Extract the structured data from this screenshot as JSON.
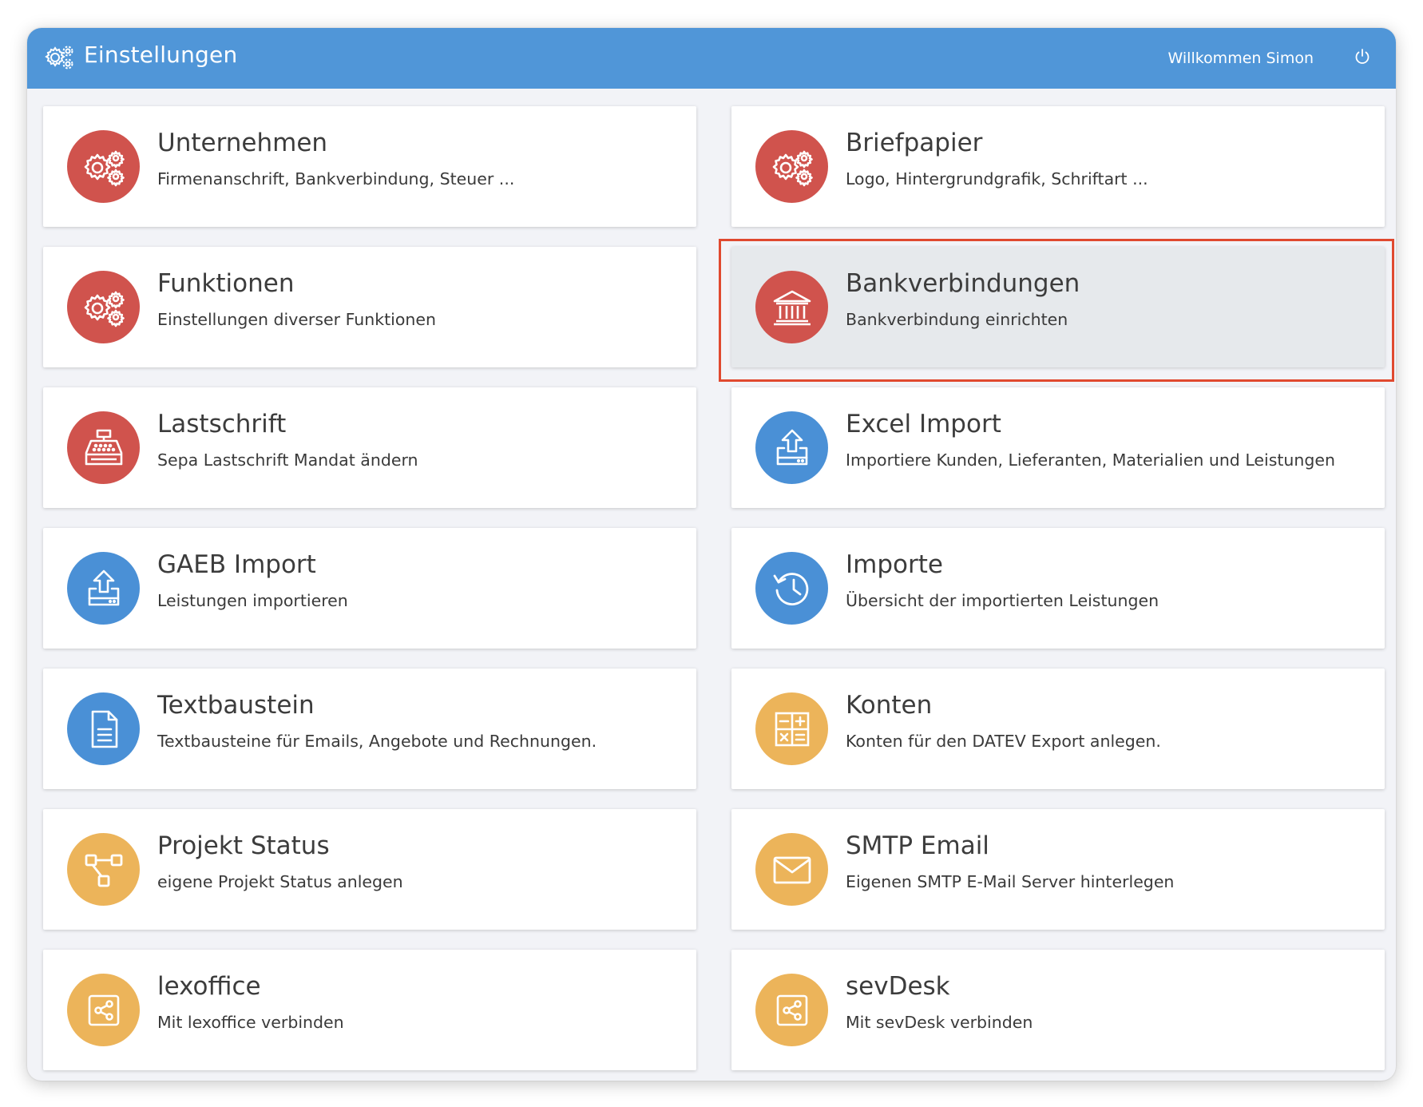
{
  "header": {
    "title": "Einstellungen",
    "welcome": "Willkommen Simon",
    "icon": "gears-icon",
    "logout_icon": "power-icon",
    "color": "#5096d8"
  },
  "colors": {
    "red": "#d0534d",
    "blue": "#4a90d6",
    "yellow": "#ecb45a",
    "highlight": "#e0492f"
  },
  "cards": [
    {
      "title": "Unternehmen",
      "subtitle": "Firmenanschrift, Bankverbindung, Steuer ...",
      "icon": "gears-icon",
      "color": "red"
    },
    {
      "title": "Briefpapier",
      "subtitle": "Logo, Hintergrundgrafik, Schriftart ...",
      "icon": "gears-icon",
      "color": "red"
    },
    {
      "title": "Funktionen",
      "subtitle": "Einstellungen diverser Funktionen",
      "icon": "gears-icon",
      "color": "red"
    },
    {
      "title": "Bankverbindungen",
      "subtitle": "Bankverbindung einrichten",
      "icon": "bank-icon",
      "color": "red",
      "active": true
    },
    {
      "title": "Lastschrift",
      "subtitle": "Sepa Lastschrift Mandat ändern",
      "icon": "cash-register-icon",
      "color": "red"
    },
    {
      "title": "Excel Import",
      "subtitle": "Importiere Kunden, Lieferanten, Materialien und Leistungen",
      "icon": "upload-icon",
      "color": "blue"
    },
    {
      "title": "GAEB Import",
      "subtitle": "Leistungen importieren",
      "icon": "upload-icon",
      "color": "blue"
    },
    {
      "title": "Importe",
      "subtitle": "Übersicht der importierten Leistungen",
      "icon": "history-icon",
      "color": "blue"
    },
    {
      "title": "Textbaustein",
      "subtitle": "Textbausteine für Emails, Angebote und Rechnungen.",
      "icon": "document-icon",
      "color": "blue"
    },
    {
      "title": "Konten",
      "subtitle": "Konten für den DATEV Export anlegen.",
      "icon": "calculator-icon",
      "color": "yellow"
    },
    {
      "title": "Projekt Status",
      "subtitle": "eigene Projekt Status anlegen",
      "icon": "workflow-icon",
      "color": "yellow"
    },
    {
      "title": "SMTP Email",
      "subtitle": "Eigenen SMTP E-Mail Server hinterlegen",
      "icon": "envelope-icon",
      "color": "yellow"
    },
    {
      "title": "lexoffice",
      "subtitle": "Mit lexoffice verbinden",
      "icon": "share-icon",
      "color": "yellow"
    },
    {
      "title": "sevDesk",
      "subtitle": "Mit sevDesk verbinden",
      "icon": "share-icon",
      "color": "yellow"
    }
  ]
}
